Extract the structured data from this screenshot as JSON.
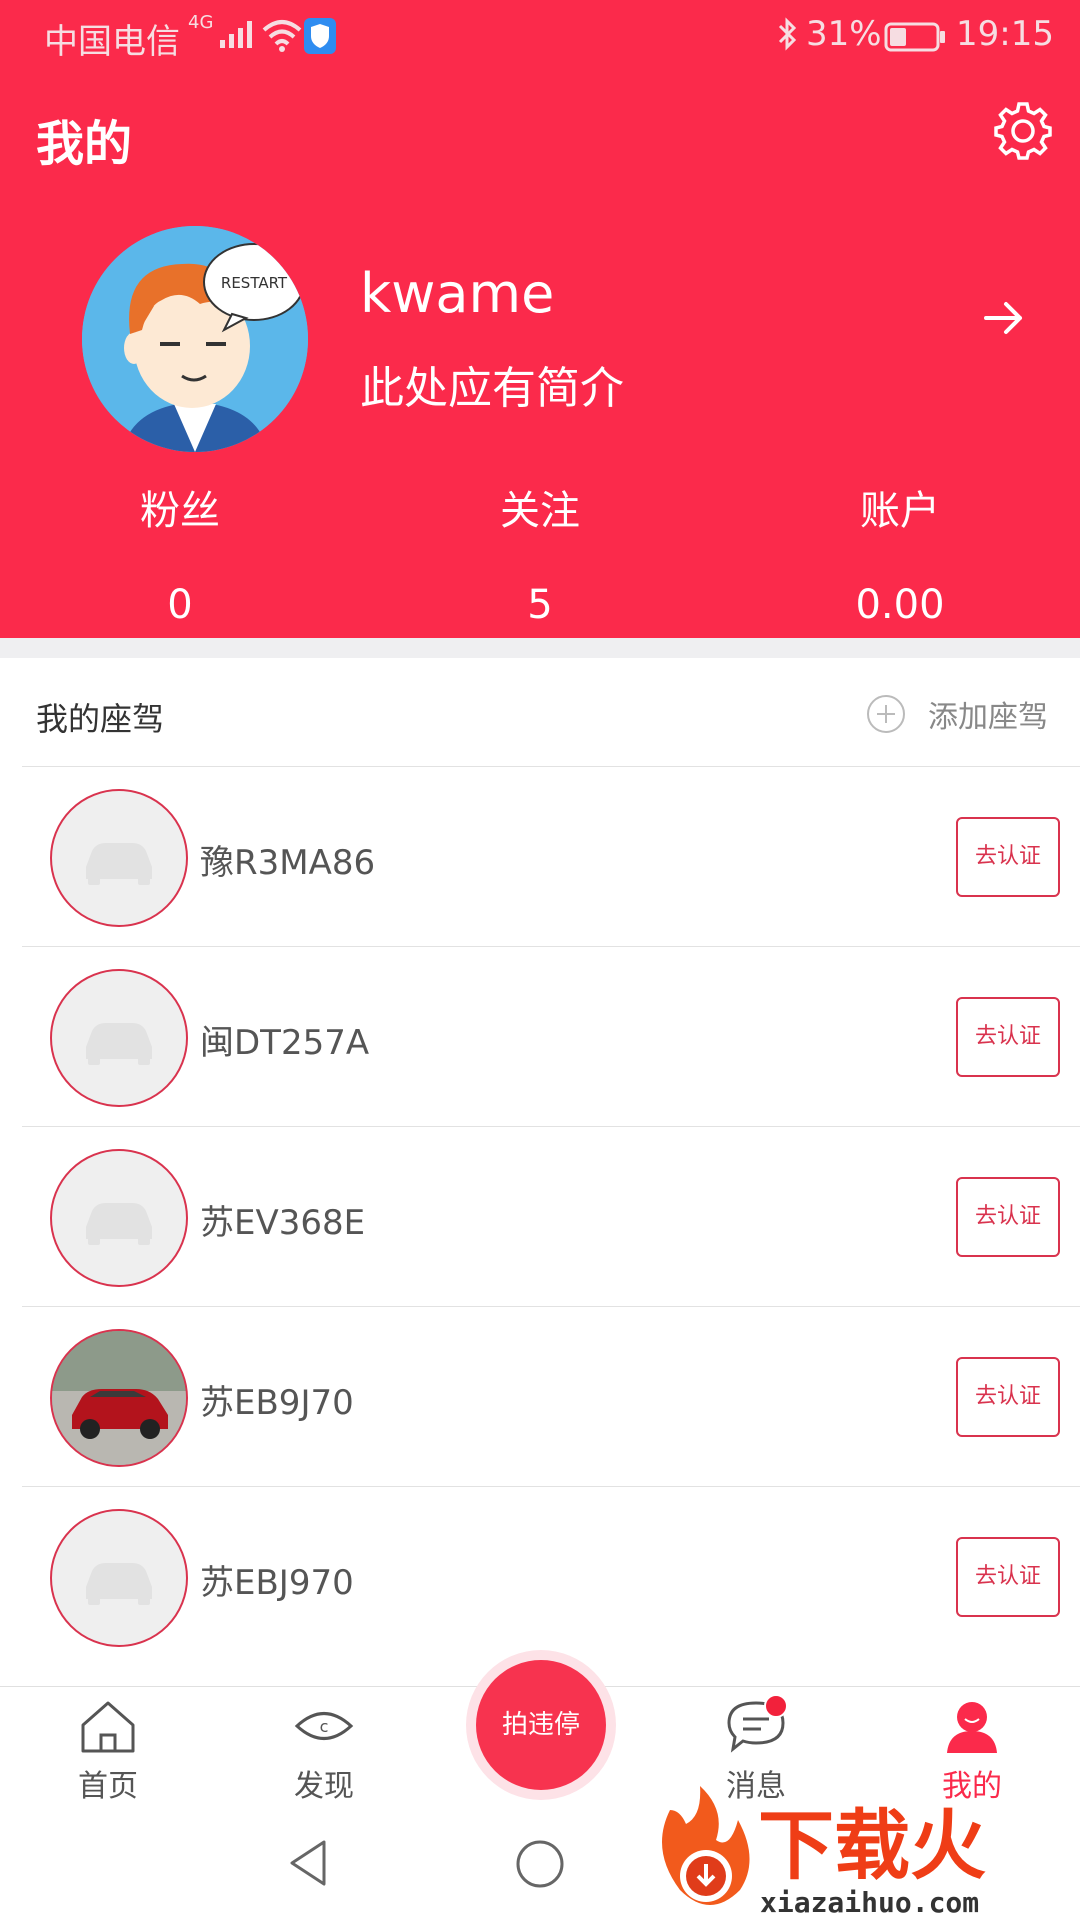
{
  "status_bar": {
    "carrier": "中国电信",
    "network": "4G",
    "battery_percent": "31%",
    "time": "19:15"
  },
  "header": {
    "title": "我的",
    "settings_icon": "gear-icon",
    "avatar_text": "RESTART",
    "username": "kwame",
    "bio": "此处应有简介",
    "arrow_icon": "arrow-right-icon"
  },
  "stats": [
    {
      "label": "粉丝",
      "value": "0"
    },
    {
      "label": "关注",
      "value": "5"
    },
    {
      "label": "账户",
      "value": "0.00"
    }
  ],
  "vehicles_section": {
    "title": "我的座驾",
    "add_label": "添加座驾"
  },
  "vehicles": [
    {
      "plate": "豫R3MA86",
      "action": "去认证",
      "has_photo": false
    },
    {
      "plate": "闽DT257A",
      "action": "去认证",
      "has_photo": false
    },
    {
      "plate": "苏EV368E",
      "action": "去认证",
      "has_photo": false
    },
    {
      "plate": "苏EB9J70",
      "action": "去认证",
      "has_photo": true
    },
    {
      "plate": "苏EBJ970",
      "action": "去认证",
      "has_photo": false
    }
  ],
  "bottom_nav": {
    "items": [
      {
        "label": "首页",
        "icon": "home-icon"
      },
      {
        "label": "发现",
        "icon": "eye-icon"
      },
      {
        "label": "拍违停",
        "icon": "camera-fab"
      },
      {
        "label": "消息",
        "icon": "message-icon"
      },
      {
        "label": "我的",
        "icon": "user-icon"
      }
    ],
    "active": "我的"
  },
  "watermark": {
    "brand": "下载火",
    "url": "xiazaihuo.com"
  },
  "colors": {
    "primary": "#fb2a4b",
    "accent_border": "#d9334e"
  }
}
